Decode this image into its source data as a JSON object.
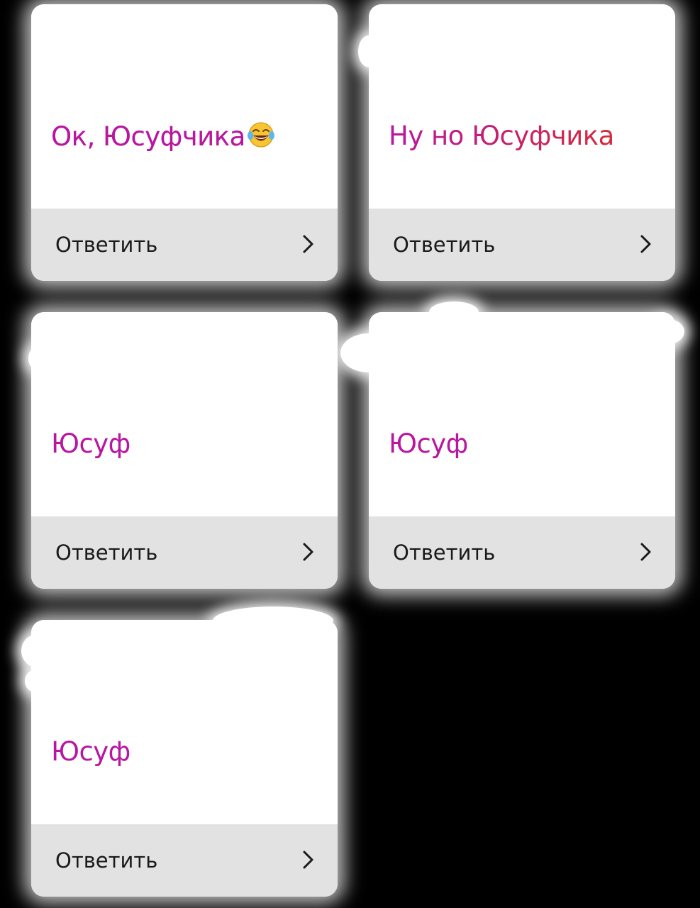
{
  "colors": {
    "background": "#000000",
    "card": "#ffffff",
    "reply_bar": "#e2e2e2",
    "message_text_gradient_start": "#b8179f",
    "message_text_gradient_end": "#d32b3b",
    "reply_text": "#1a1a1a"
  },
  "cards": [
    {
      "message": "Ок, Юсуфчика",
      "emoji": "tears-of-joy-emoji",
      "reply_label": "Ответить",
      "action_icon": "chevron-right-icon"
    },
    {
      "message": "Ну но Юсуфчика",
      "reply_label": "Ответить",
      "action_icon": "chevron-right-icon"
    },
    {
      "message": "Юсуф",
      "reply_label": "Ответить",
      "action_icon": "chevron-right-icon"
    },
    {
      "message": "Юсуф",
      "reply_label": "Ответить",
      "action_icon": "chevron-right-icon"
    },
    {
      "message": "Юсуф",
      "reply_label": "Ответить",
      "action_icon": "chevron-right-icon"
    }
  ]
}
